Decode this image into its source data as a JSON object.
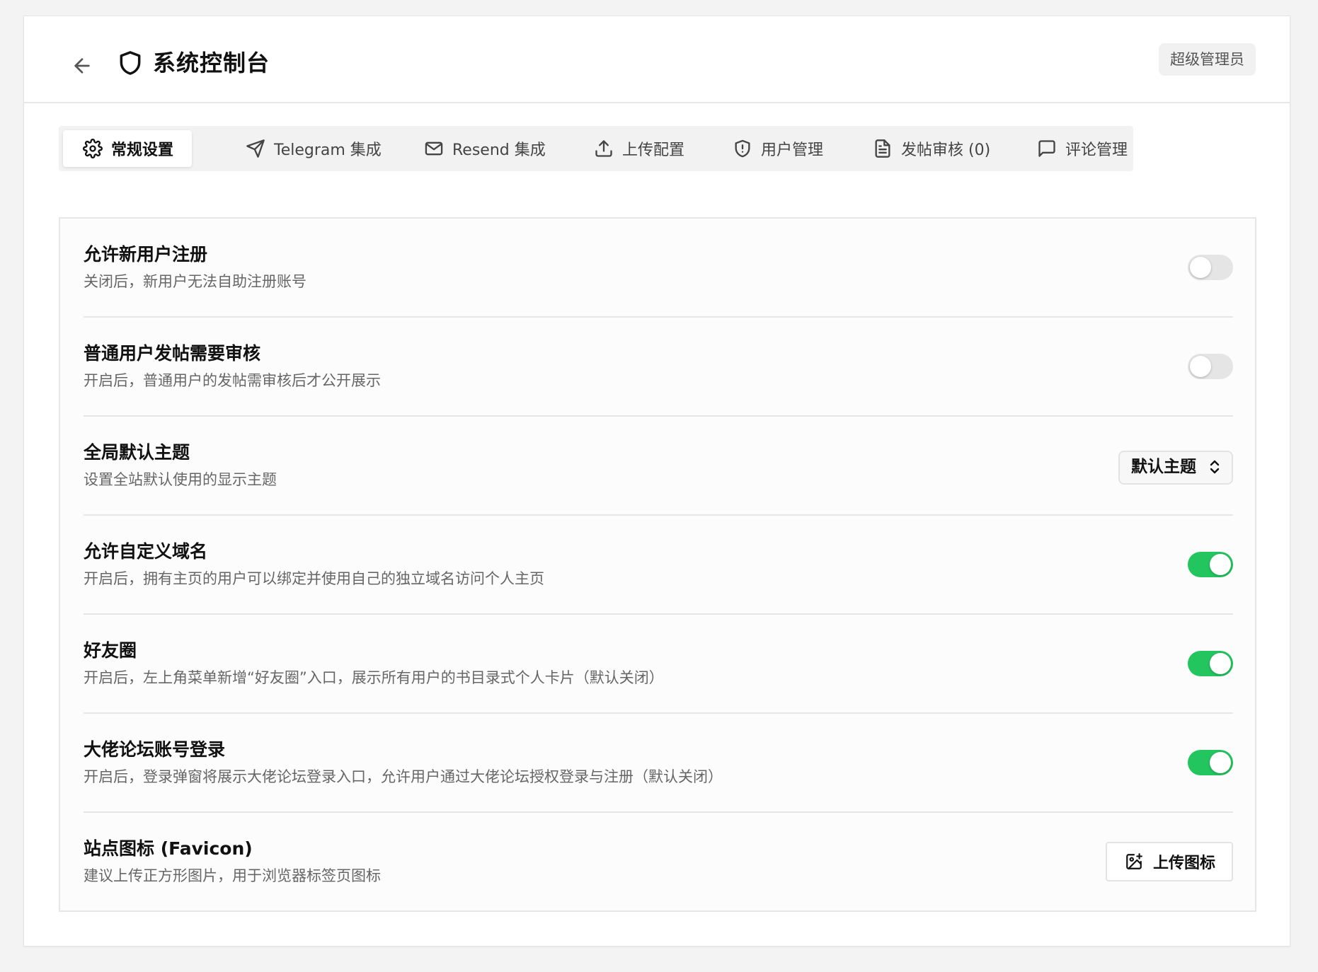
{
  "header": {
    "title": "系统控制台",
    "role_badge": "超级管理员"
  },
  "tabs": [
    {
      "label": "常规设置",
      "icon": "gear-icon",
      "active": true
    },
    {
      "label": "Telegram 集成",
      "icon": "send-icon"
    },
    {
      "label": "Resend 集成",
      "icon": "mail-icon"
    },
    {
      "label": "上传配置",
      "icon": "upload-icon"
    },
    {
      "label": "用户管理",
      "icon": "shield-alert-icon"
    },
    {
      "label": "发帖审核 (0)",
      "icon": "document-icon"
    },
    {
      "label": "评论管理",
      "icon": "comment-icon"
    }
  ],
  "settings": [
    {
      "title": "允许新用户注册",
      "desc": "关闭后，新用户无法自助注册账号",
      "control": "toggle",
      "on": false
    },
    {
      "title": "普通用户发帖需要审核",
      "desc": "开启后，普通用户的发帖需审核后才公开展示",
      "control": "toggle",
      "on": false
    },
    {
      "title": "全局默认主题",
      "desc": "设置全站默认使用的显示主题",
      "control": "select",
      "value": "默认主题"
    },
    {
      "title": "允许自定义域名",
      "desc": "开启后，拥有主页的用户可以绑定并使用自己的独立域名访问个人主页",
      "control": "toggle",
      "on": true
    },
    {
      "title": "好友圈",
      "desc": "开启后，左上角菜单新增“好友圈”入口，展示所有用户的书目录式个人卡片（默认关闭）",
      "control": "toggle",
      "on": true
    },
    {
      "title": "大佬论坛账号登录",
      "desc": "开启后，登录弹窗将展示大佬论坛登录入口，允许用户通过大佬论坛授权登录与注册（默认关闭）",
      "control": "toggle",
      "on": true
    },
    {
      "title": "站点图标 (Favicon)",
      "desc": "建议上传正方形图片，用于浏览器标签页图标",
      "control": "button",
      "button_label": "上传图标"
    }
  ],
  "colors": {
    "toggle_on": "#22c55e",
    "toggle_off": "#e5e5e5"
  }
}
